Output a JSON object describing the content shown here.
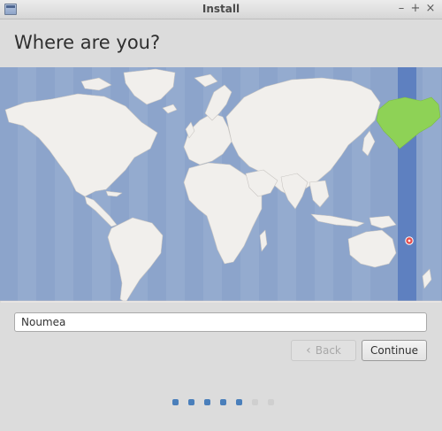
{
  "window": {
    "title": "Install",
    "controls": {
      "minimize": "–",
      "maximize": "+",
      "close": "×"
    }
  },
  "heading": "Where are you?",
  "location_input": {
    "value": "Noumea",
    "placeholder": ""
  },
  "buttons": {
    "back": "Back",
    "continue": "Continue"
  },
  "colors": {
    "ocean": "#8ca4cb",
    "land": "#f1efec",
    "selected_zone": "#5e80c0",
    "selected_region": "#8ed256",
    "pin": "#e54d4d"
  },
  "progress": {
    "steps_total": 7,
    "steps_completed": 5,
    "filled": "#4a7fbb",
    "empty": "#cfcfcf"
  }
}
